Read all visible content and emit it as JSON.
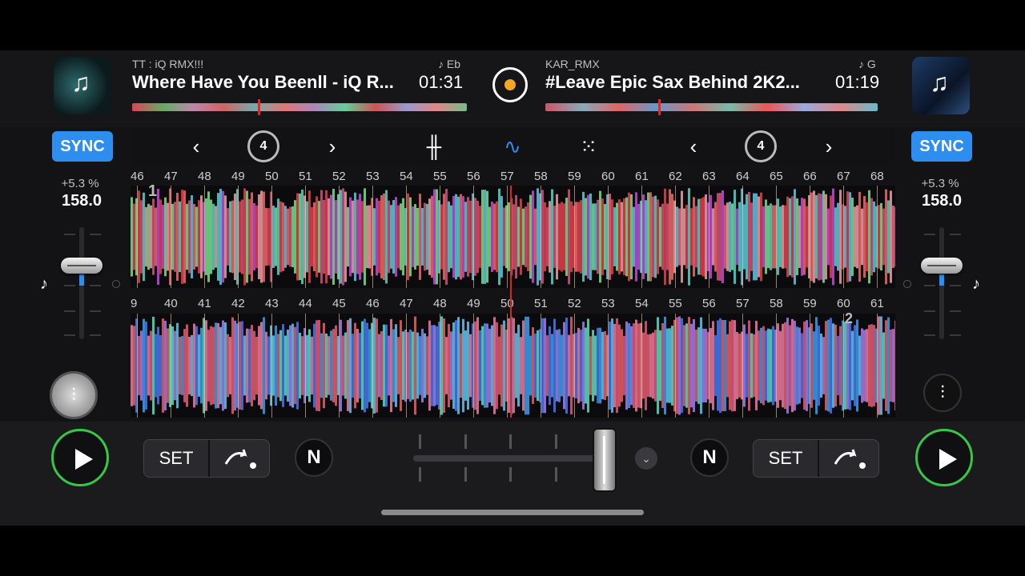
{
  "deck_left": {
    "artist": "TT : iQ RMX!!!",
    "title": "Where Have You Beenll - iQ R...",
    "time": "01:31",
    "key": "♪ Eb",
    "sync_label": "SYNC",
    "pitch_percent": "+5.3 %",
    "bpm": "158.0",
    "loop_size": "4",
    "set_label": "SET",
    "beat_numbers": [
      "46",
      "47",
      "48",
      "49",
      "50",
      "51",
      "52",
      "53",
      "54",
      "55",
      "56",
      "57",
      "58",
      "59",
      "60",
      "61",
      "62",
      "63",
      "64",
      "65",
      "66",
      "67",
      "68"
    ],
    "cue_marker": "1"
  },
  "deck_right": {
    "artist": "KAR_RMX",
    "title": "#Leave Epic Sax Behind 2K2...",
    "time": "01:19",
    "key": "♪ G",
    "sync_label": "SYNC",
    "pitch_percent": "+5.3 %",
    "bpm": "158.0",
    "loop_size": "4",
    "set_label": "SET",
    "beat_numbers": [
      "9",
      "40",
      "41",
      "42",
      "43",
      "44",
      "45",
      "46",
      "47",
      "48",
      "49",
      "50",
      "51",
      "52",
      "53",
      "54",
      "55",
      "56",
      "57",
      "58",
      "59",
      "60",
      "61"
    ],
    "cue_marker": "2"
  },
  "colors": {
    "sync": "#2e8ef0",
    "play_ring": "#36c748",
    "record_dot": "#f5a623",
    "waveform_active": "#2e8ef0"
  },
  "icons": {
    "nav_prev": "chevron-left-icon",
    "nav_next": "chevron-right-icon",
    "loop": "loop-icon",
    "mixer": "mixer-sliders-icon",
    "waveform": "waveform-icon",
    "pads": "grid-pads-icon",
    "note": "music-note-icon",
    "neural": "neural-mix-icon",
    "cue": "cue-jump-icon",
    "play": "play-icon",
    "record": "record-icon"
  },
  "crossfader": {
    "position_fraction": 0.98
  }
}
